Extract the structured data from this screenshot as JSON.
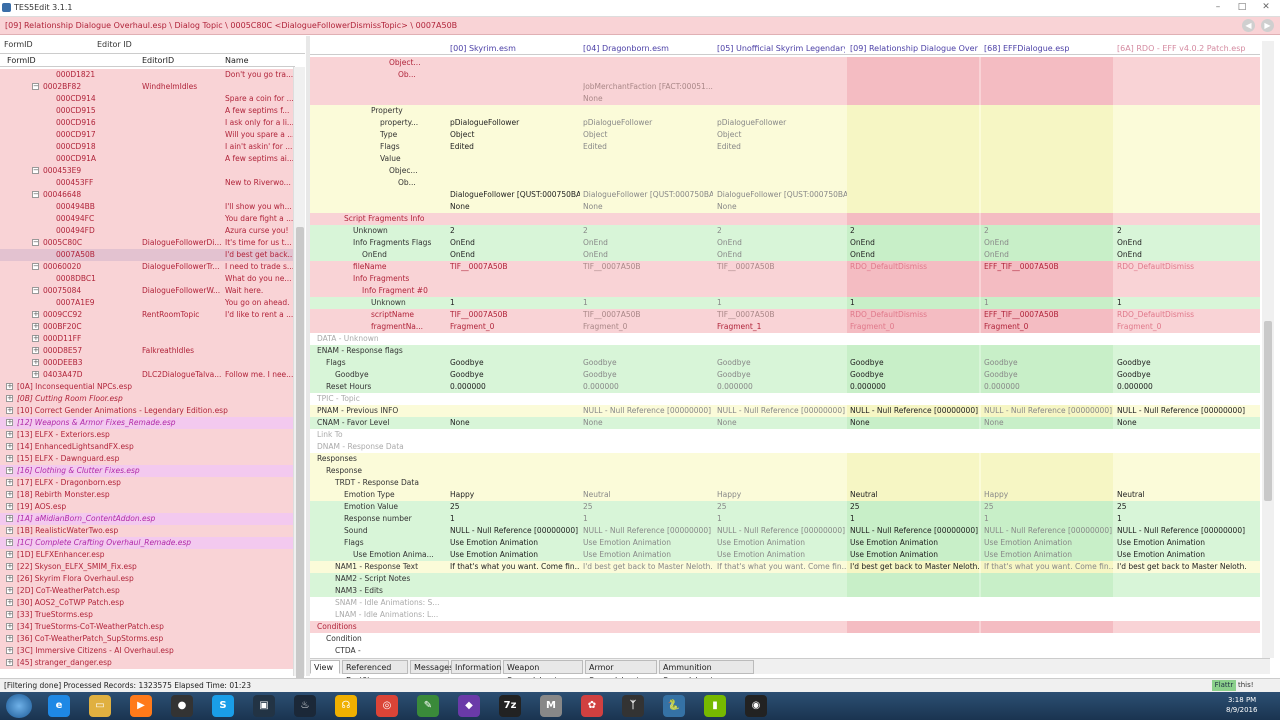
{
  "window": {
    "title": "TES5Edit 3.1.1"
  },
  "path": "[09] Relationship Dialogue Overhaul.esp \\ Dialog Topic \\ 0005C80C <DialogueFollowerDismissTopic> \\ 0007A50B",
  "filter": {
    "formid_label": "FormID",
    "editorid_label": "Editor ID"
  },
  "left_columns": {
    "formid": "FormID",
    "editorid": "EditorID",
    "name": "Name"
  },
  "left_rows": [
    {
      "indent": 3,
      "id": "000D1821",
      "eid": "",
      "name": "Don't you go tra...",
      "exp": ""
    },
    {
      "indent": 2,
      "id": "0002BF82",
      "eid": "WindhelmIdles",
      "name": "",
      "exp": "−"
    },
    {
      "indent": 3,
      "id": "000CD914",
      "eid": "",
      "name": "Spare a coin for ...",
      "exp": ""
    },
    {
      "indent": 3,
      "id": "000CD915",
      "eid": "",
      "name": "A few septims f...",
      "exp": ""
    },
    {
      "indent": 3,
      "id": "000CD916",
      "eid": "",
      "name": "I ask only for a li...",
      "exp": ""
    },
    {
      "indent": 3,
      "id": "000CD917",
      "eid": "",
      "name": "Will you spare a ...",
      "exp": ""
    },
    {
      "indent": 3,
      "id": "000CD918",
      "eid": "",
      "name": "I ain't askin' for ...",
      "exp": ""
    },
    {
      "indent": 3,
      "id": "000CD91A",
      "eid": "",
      "name": "A few septims ai...",
      "exp": ""
    },
    {
      "indent": 2,
      "id": "000453E9",
      "eid": "",
      "name": "",
      "exp": "−"
    },
    {
      "indent": 3,
      "id": "000453FF",
      "eid": "",
      "name": "New to Riverwo...",
      "exp": ""
    },
    {
      "indent": 2,
      "id": "00046648",
      "eid": "",
      "name": "",
      "exp": "−"
    },
    {
      "indent": 3,
      "id": "000494BB",
      "eid": "",
      "name": "I'll show you wh...",
      "exp": ""
    },
    {
      "indent": 3,
      "id": "000494FC",
      "eid": "",
      "name": "You dare fight a ...",
      "exp": ""
    },
    {
      "indent": 3,
      "id": "000494FD",
      "eid": "",
      "name": "Azura curse you!",
      "exp": ""
    },
    {
      "indent": 2,
      "id": "0005C80C",
      "eid": "DialogueFollowerDi...",
      "name": "It's time for us t...",
      "exp": "−"
    },
    {
      "indent": 3,
      "id": "0007A50B",
      "eid": "",
      "name": "I'd best get back...",
      "exp": "",
      "selected": true
    },
    {
      "indent": 2,
      "id": "00060020",
      "eid": "DialogueFollowerTr...",
      "name": "I need to trade s...",
      "exp": "−"
    },
    {
      "indent": 3,
      "id": "0008DBC1",
      "eid": "",
      "name": "What do you ne...",
      "exp": ""
    },
    {
      "indent": 2,
      "id": "00075084",
      "eid": "DialogueFollowerW...",
      "name": "Wait here.",
      "exp": "−"
    },
    {
      "indent": 3,
      "id": "0007A1E9",
      "eid": "",
      "name": "You go on ahead.",
      "exp": ""
    },
    {
      "indent": 2,
      "id": "0009CC92",
      "eid": "RentRoomTopic",
      "name": "I'd like to rent a ...",
      "exp": "+"
    },
    {
      "indent": 2,
      "id": "000BF20C",
      "eid": "",
      "name": "",
      "exp": "+"
    },
    {
      "indent": 2,
      "id": "000D11FF",
      "eid": "",
      "name": "",
      "exp": "+"
    },
    {
      "indent": 2,
      "id": "000D8E57",
      "eid": "FalkreathIdles",
      "name": "",
      "exp": "+"
    },
    {
      "indent": 2,
      "id": "000DEEB3",
      "eid": "",
      "name": "",
      "exp": "+"
    },
    {
      "indent": 2,
      "id": "0403A47D",
      "eid": "DLC2DialogueTalva...",
      "name": "Follow me. I nee...",
      "exp": "+"
    },
    {
      "indent": 0,
      "id": "[0A] Inconsequential NPCs.esp",
      "eid": "",
      "name": "",
      "exp": "+",
      "plugin": true
    },
    {
      "indent": 0,
      "id": "[0B] Cutting Room Floor.esp",
      "eid": "",
      "name": "",
      "exp": "+",
      "plugin": true,
      "italic": true
    },
    {
      "indent": 0,
      "id": "[10] Correct Gender Animations - Legendary Edition.esp",
      "eid": "",
      "name": "",
      "exp": "+",
      "plugin": true
    },
    {
      "indent": 0,
      "id": "[12] Weapons & Armor Fixes_Remade.esp",
      "eid": "",
      "name": "",
      "exp": "+",
      "plugin": true,
      "italic": true,
      "pink": true
    },
    {
      "indent": 0,
      "id": "[13] ELFX - Exteriors.esp",
      "eid": "",
      "name": "",
      "exp": "+",
      "plugin": true
    },
    {
      "indent": 0,
      "id": "[14] EnhancedLightsandFX.esp",
      "eid": "",
      "name": "",
      "exp": "+",
      "plugin": true
    },
    {
      "indent": 0,
      "id": "[15] ELFX - Dawnguard.esp",
      "eid": "",
      "name": "",
      "exp": "+",
      "plugin": true
    },
    {
      "indent": 0,
      "id": "[16] Clothing & Clutter Fixes.esp",
      "eid": "",
      "name": "",
      "exp": "+",
      "plugin": true,
      "italic": true,
      "pink": true
    },
    {
      "indent": 0,
      "id": "[17] ELFX - Dragonborn.esp",
      "eid": "",
      "name": "",
      "exp": "+",
      "plugin": true
    },
    {
      "indent": 0,
      "id": "[18] Rebirth Monster.esp",
      "eid": "",
      "name": "",
      "exp": "+",
      "plugin": true
    },
    {
      "indent": 0,
      "id": "[19] AOS.esp",
      "eid": "",
      "name": "",
      "exp": "+",
      "plugin": true
    },
    {
      "indent": 0,
      "id": "[1A] aMidianBorn_ContentAddon.esp",
      "eid": "",
      "name": "",
      "exp": "+",
      "plugin": true,
      "italic": true,
      "pink": true
    },
    {
      "indent": 0,
      "id": "[1B] RealisticWaterTwo.esp",
      "eid": "",
      "name": "",
      "exp": "+",
      "plugin": true
    },
    {
      "indent": 0,
      "id": "[1C] Complete Crafting Overhaul_Remade.esp",
      "eid": "",
      "name": "",
      "exp": "+",
      "plugin": true,
      "italic": true,
      "pink": true
    },
    {
      "indent": 0,
      "id": "[1D] ELFXEnhancer.esp",
      "eid": "",
      "name": "",
      "exp": "+",
      "plugin": true
    },
    {
      "indent": 0,
      "id": "[22] Skyson_ELFX_SMIM_Fix.esp",
      "eid": "",
      "name": "",
      "exp": "+",
      "plugin": true
    },
    {
      "indent": 0,
      "id": "[26] Skyrim Flora Overhaul.esp",
      "eid": "",
      "name": "",
      "exp": "+",
      "plugin": true
    },
    {
      "indent": 0,
      "id": "[2D] CoT-WeatherPatch.esp",
      "eid": "",
      "name": "",
      "exp": "+",
      "plugin": true
    },
    {
      "indent": 0,
      "id": "[30] AOS2_CoTWP Patch.esp",
      "eid": "",
      "name": "",
      "exp": "+",
      "plugin": true
    },
    {
      "indent": 0,
      "id": "[33] TrueStorms.esp",
      "eid": "",
      "name": "",
      "exp": "+",
      "plugin": true
    },
    {
      "indent": 0,
      "id": "[34] TrueStorms-CoT-WeatherPatch.esp",
      "eid": "",
      "name": "",
      "exp": "+",
      "plugin": true
    },
    {
      "indent": 0,
      "id": "[36] CoT-WeatherPatch_SupStorms.esp",
      "eid": "",
      "name": "",
      "exp": "+",
      "plugin": true
    },
    {
      "indent": 0,
      "id": "[3C] Immersive Citizens - AI Overhaul.esp",
      "eid": "",
      "name": "",
      "exp": "+",
      "plugin": true
    },
    {
      "indent": 0,
      "id": "[45] stranger_danger.esp",
      "eid": "",
      "name": "",
      "exp": "+",
      "plugin": true
    }
  ],
  "right_columns": [
    "[00] Skyrim.esm",
    "[04] Dragonborn.esm",
    "[05] Unofficial Skyrim Legendary ...",
    "[09] Relationship Dialogue Overha...",
    "[68] EFFDialogue.esp",
    "[6A] RDO - EFF v4.0.2 Patch.esp"
  ],
  "right_rows": [
    {
      "indent": 8,
      "label": "Object...",
      "bg": "pink",
      "v": [
        "",
        "",
        "",
        "",
        "",
        ""
      ]
    },
    {
      "indent": 9,
      "label": "Ob...",
      "bg": "pink",
      "v": [
        "",
        "",
        "",
        "",
        "",
        ""
      ]
    },
    {
      "indent": 0,
      "label": "",
      "bg": "pink",
      "v": [
        "",
        "JobMerchantFaction [FACT:00051...",
        "",
        "",
        "",
        ""
      ]
    },
    {
      "indent": 0,
      "label": "",
      "bg": "pink",
      "v": [
        "",
        "None",
        "",
        "",
        "",
        ""
      ]
    },
    {
      "indent": 6,
      "label": "Property",
      "bg": "yellow",
      "v": [
        "",
        "",
        "",
        "",
        "",
        ""
      ]
    },
    {
      "indent": 7,
      "label": "property...",
      "bg": "yellow",
      "v": [
        "pDialogueFollower",
        "pDialogueFollower",
        "pDialogueFollower",
        "",
        "",
        ""
      ]
    },
    {
      "indent": 7,
      "label": "Type",
      "bg": "yellow",
      "v": [
        "Object",
        "Object",
        "Object",
        "",
        "",
        ""
      ]
    },
    {
      "indent": 7,
      "label": "Flags",
      "bg": "yellow",
      "v": [
        "Edited",
        "Edited",
        "Edited",
        "",
        "",
        ""
      ]
    },
    {
      "indent": 7,
      "label": "Value",
      "bg": "yellow",
      "v": [
        "",
        "",
        "",
        "",
        "",
        ""
      ]
    },
    {
      "indent": 8,
      "label": "Objec...",
      "bg": "yellow",
      "v": [
        "",
        "",
        "",
        "",
        "",
        ""
      ]
    },
    {
      "indent": 9,
      "label": "Ob...",
      "bg": "yellow",
      "v": [
        "",
        "",
        "",
        "",
        "",
        ""
      ]
    },
    {
      "indent": 0,
      "label": "",
      "bg": "yellow",
      "v": [
        "DialogueFollower [QUST:000750BA]",
        "DialogueFollower [QUST:000750BA]",
        "DialogueFollower [QUST:000750BA]",
        "",
        "",
        ""
      ]
    },
    {
      "indent": 0,
      "label": "",
      "bg": "yellow",
      "v": [
        "None",
        "None",
        "None",
        "",
        "",
        ""
      ]
    },
    {
      "indent": 3,
      "label": "Script Fragments Info",
      "bg": "pink",
      "v": [
        "",
        "",
        "",
        "",
        "",
        ""
      ]
    },
    {
      "indent": 4,
      "label": "Unknown",
      "bg": "green",
      "v": [
        "2",
        "2",
        "2",
        "2",
        "2",
        "2"
      ]
    },
    {
      "indent": 4,
      "label": "Info Fragments Flags",
      "bg": "green",
      "v": [
        "OnEnd",
        "OnEnd",
        "OnEnd",
        "OnEnd",
        "OnEnd",
        "OnEnd"
      ]
    },
    {
      "indent": 5,
      "label": "OnEnd",
      "bg": "green",
      "v": [
        "OnEnd",
        "OnEnd",
        "OnEnd",
        "OnEnd",
        "OnEnd",
        "OnEnd"
      ]
    },
    {
      "indent": 4,
      "label": "fileName",
      "bg": "pink",
      "v": [
        "TIF__0007A50B",
        "TIF__0007A50B",
        "TIF__0007A50B",
        "RDO_DefaultDismiss",
        "EFF_TIF__0007A50B",
        "RDO_DefaultDismiss"
      ]
    },
    {
      "indent": 4,
      "label": "Info Fragments",
      "bg": "pink",
      "v": [
        "",
        "",
        "",
        "",
        "",
        ""
      ]
    },
    {
      "indent": 5,
      "label": "Info Fragment #0",
      "bg": "pink",
      "v": [
        "",
        "",
        "",
        "",
        "",
        ""
      ]
    },
    {
      "indent": 6,
      "label": "Unknown",
      "bg": "green",
      "v": [
        "1",
        "1",
        "1",
        "1",
        "1",
        "1"
      ]
    },
    {
      "indent": 6,
      "label": "scriptName",
      "bg": "pink",
      "v": [
        "TIF__0007A50B",
        "TIF__0007A50B",
        "TIF__0007A50B",
        "RDO_DefaultDismiss",
        "EFF_TIF__0007A50B",
        "RDO_DefaultDismiss"
      ]
    },
    {
      "indent": 6,
      "label": "fragmentNa...",
      "bg": "pink",
      "v": [
        "Fragment_0",
        "Fragment_0",
        "Fragment_1",
        "Fragment_0",
        "Fragment_0",
        "Fragment_0"
      ]
    },
    {
      "indent": 0,
      "label": "DATA - Unknown",
      "bg": "white",
      "muted": true,
      "v": [
        "",
        "",
        "",
        "",
        "",
        ""
      ]
    },
    {
      "indent": 0,
      "label": "ENAM - Response flags",
      "bg": "green",
      "v": [
        "",
        "",
        "",
        "",
        "",
        ""
      ]
    },
    {
      "indent": 1,
      "label": "Flags",
      "bg": "green",
      "v": [
        "Goodbye",
        "Goodbye",
        "Goodbye",
        "Goodbye",
        "Goodbye",
        "Goodbye"
      ]
    },
    {
      "indent": 2,
      "label": "Goodbye",
      "bg": "green",
      "v": [
        "Goodbye",
        "Goodbye",
        "Goodbye",
        "Goodbye",
        "Goodbye",
        "Goodbye"
      ]
    },
    {
      "indent": 1,
      "label": "Reset Hours",
      "bg": "green",
      "v": [
        "0.000000",
        "0.000000",
        "0.000000",
        "0.000000",
        "0.000000",
        "0.000000"
      ]
    },
    {
      "indent": 0,
      "label": "TPIC - Topic",
      "bg": "white",
      "muted": true,
      "v": [
        "",
        "",
        "",
        "",
        "",
        ""
      ]
    },
    {
      "indent": 0,
      "label": "PNAM - Previous INFO",
      "bg": "yellow",
      "v": [
        "",
        "NULL - Null Reference [00000000]",
        "NULL - Null Reference [00000000]",
        "NULL - Null Reference [00000000]",
        "NULL - Null Reference [00000000]",
        "NULL - Null Reference [00000000]"
      ]
    },
    {
      "indent": 0,
      "label": "CNAM - Favor Level",
      "bg": "green",
      "v": [
        "None",
        "None",
        "None",
        "None",
        "None",
        "None"
      ]
    },
    {
      "indent": 0,
      "label": "Link To",
      "bg": "white",
      "muted": true,
      "v": [
        "",
        "",
        "",
        "",
        "",
        ""
      ]
    },
    {
      "indent": 0,
      "label": "DNAM - Response Data",
      "bg": "white",
      "muted": true,
      "v": [
        "",
        "",
        "",
        "",
        "",
        ""
      ]
    },
    {
      "indent": 0,
      "label": "Responses",
      "bg": "yellow",
      "v": [
        "",
        "",
        "",
        "",
        "",
        ""
      ]
    },
    {
      "indent": 1,
      "label": "Response",
      "bg": "yellow",
      "v": [
        "",
        "",
        "",
        "",
        "",
        ""
      ]
    },
    {
      "indent": 2,
      "label": "TRDT - Response Data",
      "bg": "yellow",
      "v": [
        "",
        "",
        "",
        "",
        "",
        ""
      ]
    },
    {
      "indent": 3,
      "label": "Emotion Type",
      "bg": "yellow",
      "v": [
        "Happy",
        "Neutral",
        "Happy",
        "Neutral",
        "Happy",
        "Neutral"
      ]
    },
    {
      "indent": 3,
      "label": "Emotion Value",
      "bg": "green",
      "v": [
        "25",
        "25",
        "25",
        "25",
        "25",
        "25"
      ]
    },
    {
      "indent": 3,
      "label": "Response number",
      "bg": "green",
      "v": [
        "1",
        "1",
        "1",
        "1",
        "1",
        "1"
      ]
    },
    {
      "indent": 3,
      "label": "Sound",
      "bg": "green",
      "v": [
        "NULL - Null Reference [00000000]",
        "NULL - Null Reference [00000000]",
        "NULL - Null Reference [00000000]",
        "NULL - Null Reference [00000000]",
        "NULL - Null Reference [00000000]",
        "NULL - Null Reference [00000000]"
      ]
    },
    {
      "indent": 3,
      "label": "Flags",
      "bg": "green",
      "v": [
        "Use Emotion Animation",
        "Use Emotion Animation",
        "Use Emotion Animation",
        "Use Emotion Animation",
        "Use Emotion Animation",
        "Use Emotion Animation"
      ]
    },
    {
      "indent": 4,
      "label": "Use Emotion Anima...",
      "bg": "green",
      "v": [
        "Use Emotion Animation",
        "Use Emotion Animation",
        "Use Emotion Animation",
        "Use Emotion Animation",
        "Use Emotion Animation",
        "Use Emotion Animation"
      ]
    },
    {
      "indent": 2,
      "label": "NAM1 - Response Text",
      "bg": "yellow",
      "v": [
        "If that's what you want. Come fin...",
        "I'd best get back to Master Neloth...",
        "If that's what you want. Come fin...",
        "I'd best get back to Master Neloth...",
        "If that's what you want. Come fin...",
        "I'd best get back to Master Neloth..."
      ]
    },
    {
      "indent": 2,
      "label": "NAM2 - Script Notes",
      "bg": "green",
      "v": [
        "",
        "",
        "",
        "",
        "",
        ""
      ]
    },
    {
      "indent": 2,
      "label": "NAM3 - Edits",
      "bg": "green",
      "v": [
        "",
        "",
        "",
        "",
        "",
        ""
      ]
    },
    {
      "indent": 2,
      "label": "SNAM - Idle Animations: S...",
      "bg": "white",
      "muted": true,
      "v": [
        "",
        "",
        "",
        "",
        "",
        ""
      ]
    },
    {
      "indent": 2,
      "label": "LNAM - Idle Animations: L...",
      "bg": "white",
      "muted": true,
      "v": [
        "",
        "",
        "",
        "",
        "",
        ""
      ]
    },
    {
      "indent": 0,
      "label": "Conditions",
      "bg": "pink",
      "v": [
        "",
        "",
        "",
        "",
        "",
        ""
      ]
    },
    {
      "indent": 1,
      "label": "Condition",
      "bg": "white",
      "v": [
        "",
        "",
        "",
        "",
        "",
        ""
      ]
    },
    {
      "indent": 2,
      "label": "CTDA -",
      "bg": "white",
      "v": [
        "",
        "",
        "",
        "",
        "",
        ""
      ]
    }
  ],
  "tabs": [
    "View",
    "Referenced By (6)",
    "Messages",
    "Information",
    "Weapon Spreadsheet",
    "Armor Spreadsheet",
    "Ammunition Spreadsheet"
  ],
  "status": {
    "text": "[Filtering done]  Processed Records: 1323575 Elapsed Time: 01:23",
    "flattr": "Flattr",
    "this": "this!"
  },
  "taskbar": {
    "time": "3:18 PM",
    "date": "8/9/2016",
    "apps": [
      "ie-icon",
      "explorer-icon",
      "media-icon",
      "obs-icon",
      "skype-icon",
      "app-icon",
      "steam-icon",
      "headset-icon",
      "chrome-icon",
      "notepad-icon",
      "vs-icon",
      "7zip-icon",
      "mo-icon",
      "tool-icon",
      "skyrim-icon",
      "python-icon",
      "nvidia-icon",
      "tes5edit-icon"
    ]
  },
  "colors": {
    "pink": "#f9d3d6",
    "yellow": "#fbfbd9",
    "green": "#d8f5d8",
    "white": "#ffffff",
    "pinkText": "#b0243a",
    "muted": "#aaa"
  }
}
